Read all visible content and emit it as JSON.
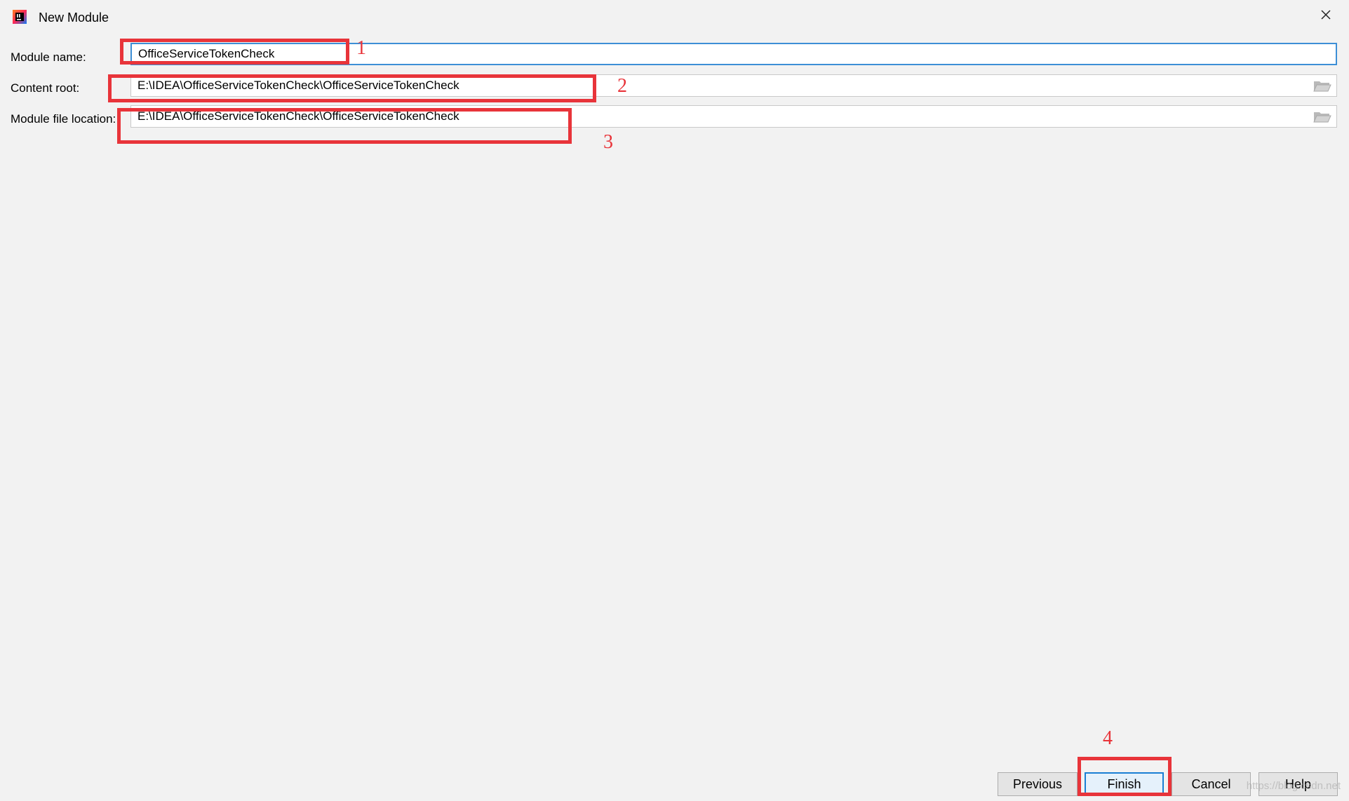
{
  "window": {
    "title": "New Module"
  },
  "form": {
    "module_name": {
      "label": "Module name:",
      "value": "OfficeServiceTokenCheck"
    },
    "content_root": {
      "label": "Content root:",
      "value": "E:\\IDEA\\OfficeServiceTokenCheck\\OfficeServiceTokenCheck"
    },
    "module_file_location": {
      "label": "Module file location:",
      "value": "E:\\IDEA\\OfficeServiceTokenCheck\\OfficeServiceTokenCheck"
    }
  },
  "annotations": {
    "n1": "1",
    "n2": "2",
    "n3": "3",
    "n4": "4",
    "color": "#e8343a"
  },
  "buttons": {
    "previous": "Previous",
    "finish": "Finish",
    "cancel": "Cancel",
    "help": "Help"
  },
  "watermark": "https://blog.csdn.net",
  "icons": {
    "app": "intellij-idea-icon",
    "close": "close-icon",
    "folder": "folder-icon"
  },
  "colors": {
    "accent": "#3d8fd6",
    "default_button_border": "#1a7fd4",
    "background": "#f2f2f2"
  }
}
